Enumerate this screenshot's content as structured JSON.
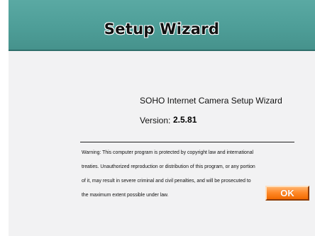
{
  "header": {
    "title": "Setup Wizard"
  },
  "main": {
    "product_name": "SOHO Internet Camera Setup Wizard",
    "version_label": "Version:",
    "version_value": "2.5.81",
    "warning_lines": [
      "Warning: This computer program is protected by copyright law and international",
      "treaties.  Unauthorized reproduction or distribution of this program, or any portion",
      "of it, may result  in severe criminal and civil penalties, and will be prosecuted to",
      "the maximum extent possible under law."
    ]
  },
  "buttons": {
    "ok_label": "OK"
  },
  "colors": {
    "header_bg": "#4e9e98",
    "panel_bg": "#f2f2f3",
    "ok_button": "#ff8a2a"
  }
}
